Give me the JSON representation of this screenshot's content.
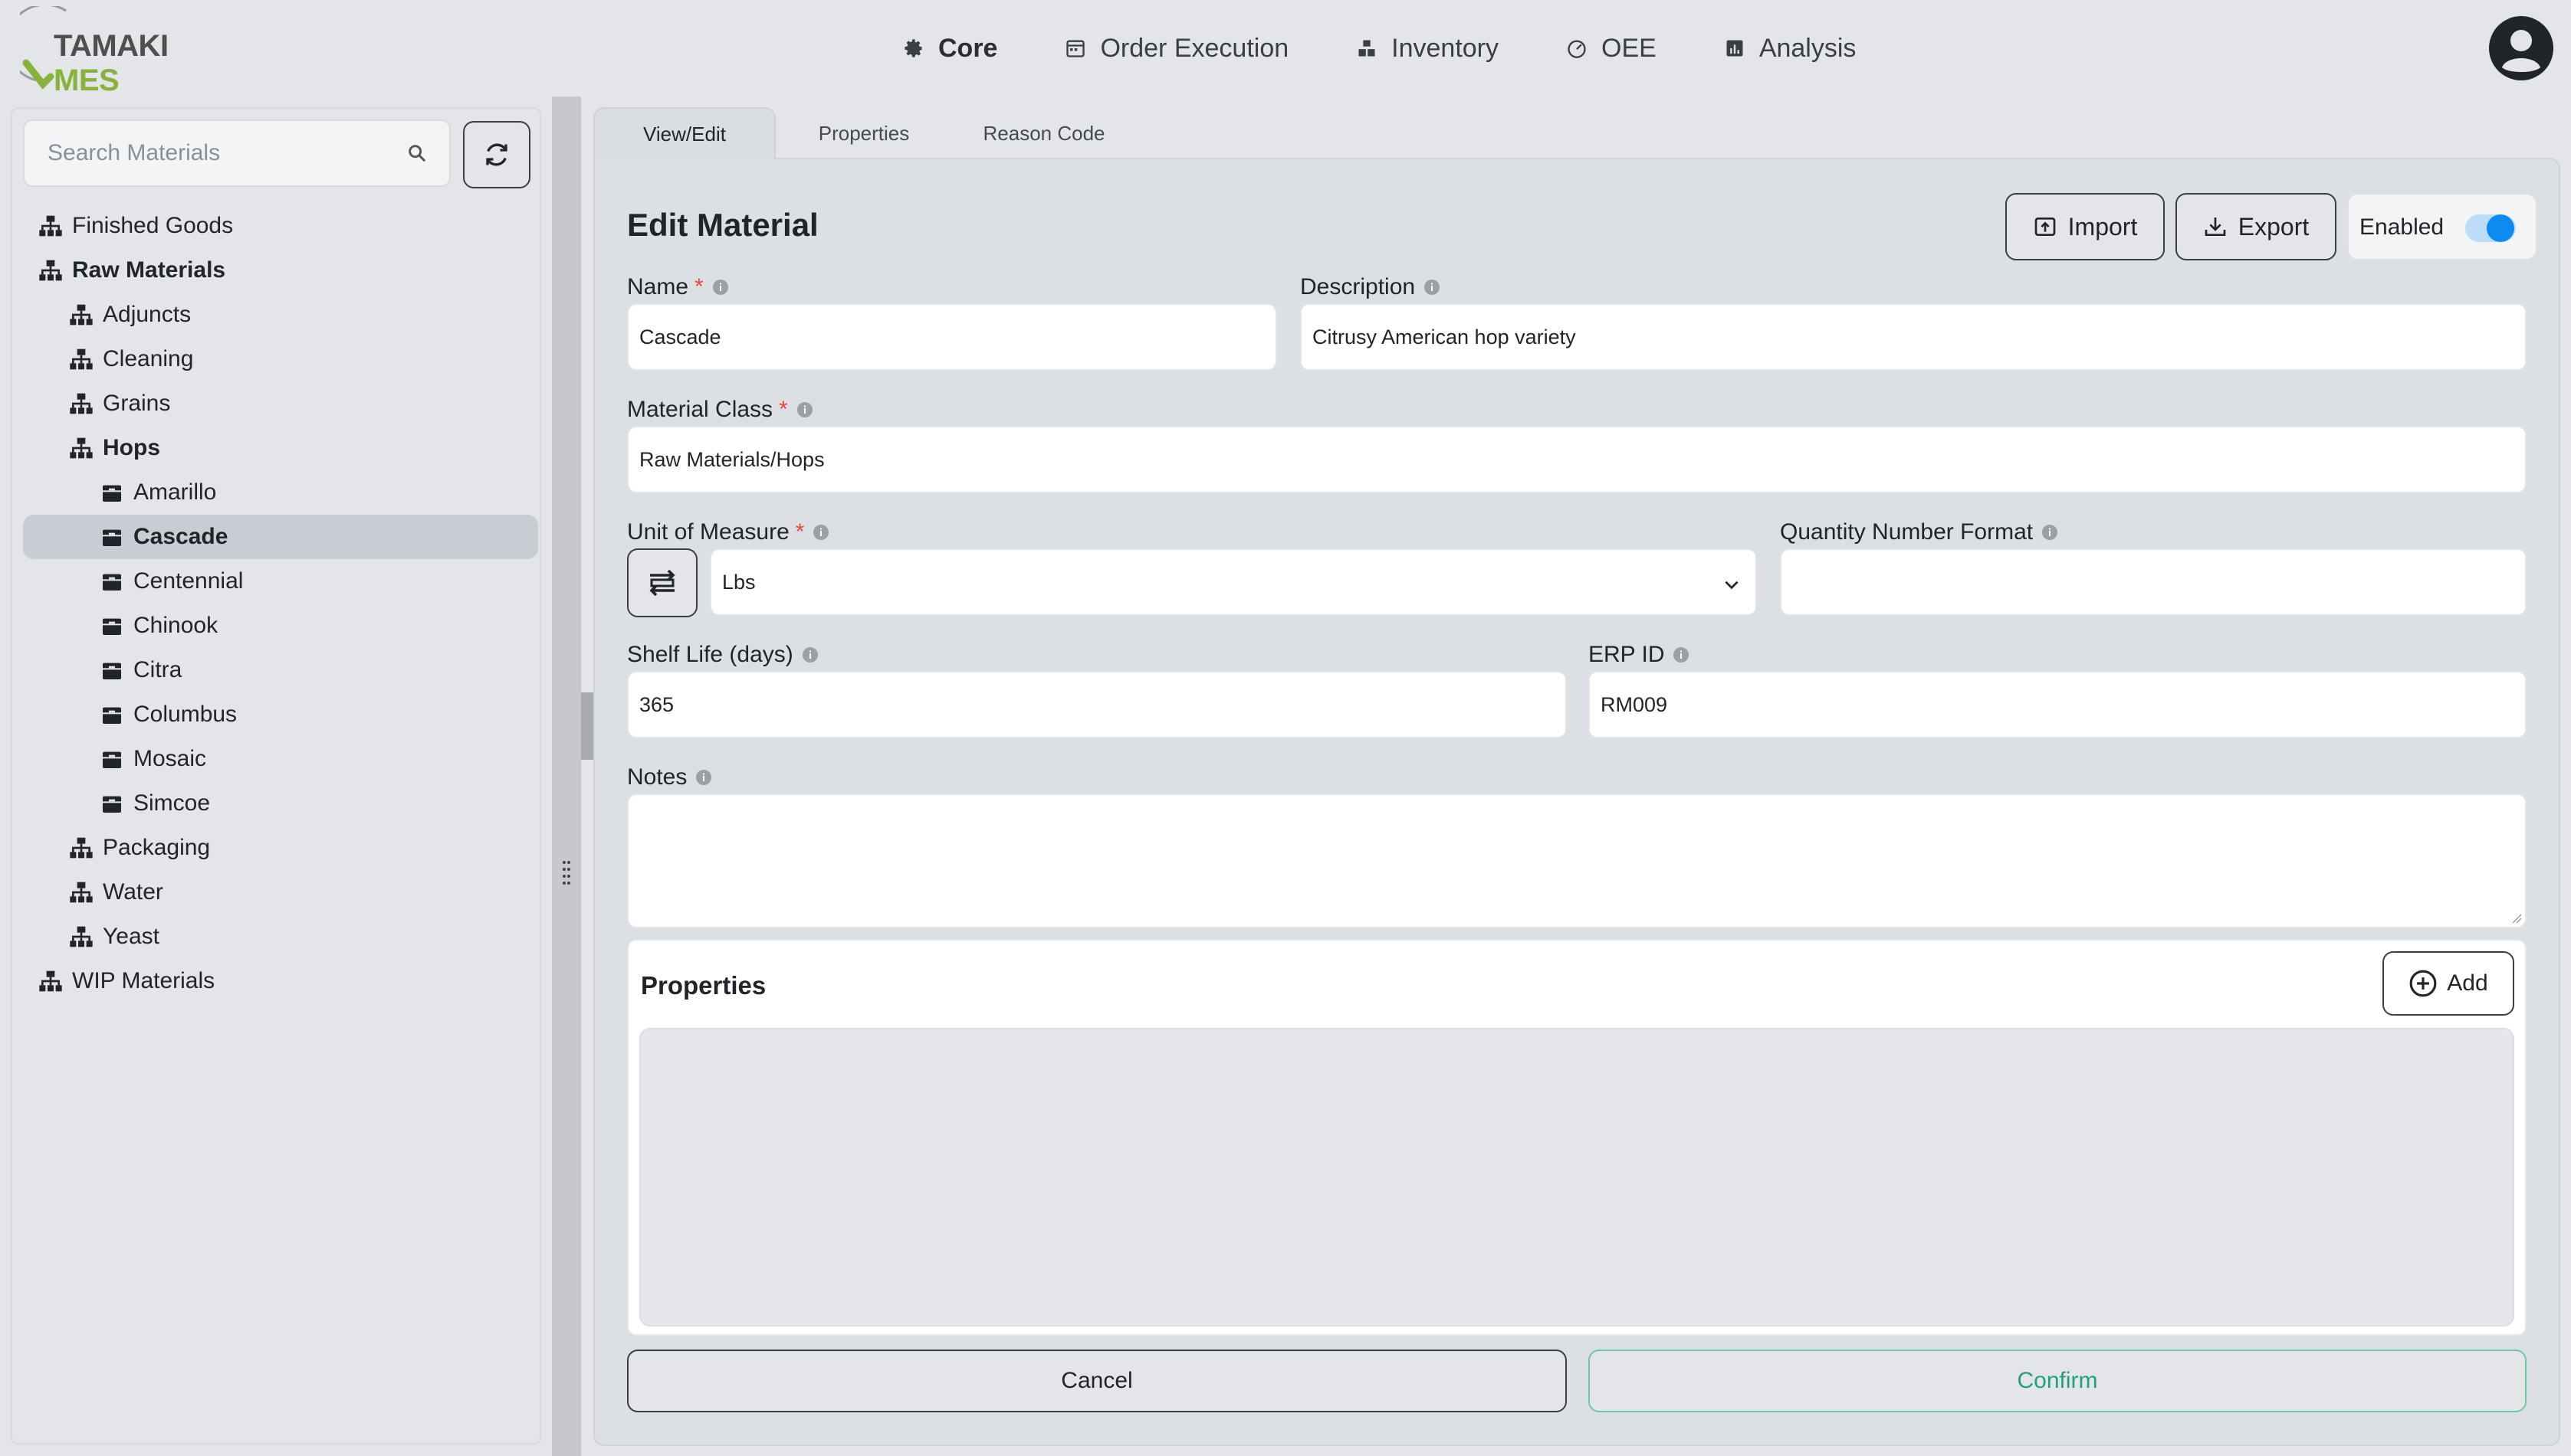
{
  "brand": {
    "part1": "TAMAKI",
    "part2": "MES",
    "accent": "#88b23d"
  },
  "nav": {
    "items": [
      {
        "label": "Core",
        "icon": "gear-icon",
        "active": true
      },
      {
        "label": "Order Execution",
        "icon": "calendar-icon",
        "active": false
      },
      {
        "label": "Inventory",
        "icon": "boxes-icon",
        "active": false
      },
      {
        "label": "OEE",
        "icon": "gauge-icon",
        "active": false
      },
      {
        "label": "Analysis",
        "icon": "chart-icon",
        "active": false
      }
    ]
  },
  "sidebar": {
    "search_placeholder": "Search Materials",
    "tree": [
      {
        "label": "Finished Goods",
        "level": 0,
        "type": "class",
        "bold": false
      },
      {
        "label": "Raw Materials",
        "level": 0,
        "type": "class",
        "bold": true
      },
      {
        "label": "Adjuncts",
        "level": 1,
        "type": "class",
        "bold": false
      },
      {
        "label": "Cleaning",
        "level": 1,
        "type": "class",
        "bold": false
      },
      {
        "label": "Grains",
        "level": 1,
        "type": "class",
        "bold": false
      },
      {
        "label": "Hops",
        "level": 1,
        "type": "class",
        "bold": true
      },
      {
        "label": "Amarillo",
        "level": 2,
        "type": "material",
        "bold": false
      },
      {
        "label": "Cascade",
        "level": 2,
        "type": "material",
        "bold": true,
        "selected": true
      },
      {
        "label": "Centennial",
        "level": 2,
        "type": "material",
        "bold": false
      },
      {
        "label": "Chinook",
        "level": 2,
        "type": "material",
        "bold": false
      },
      {
        "label": "Citra",
        "level": 2,
        "type": "material",
        "bold": false
      },
      {
        "label": "Columbus",
        "level": 2,
        "type": "material",
        "bold": false
      },
      {
        "label": "Mosaic",
        "level": 2,
        "type": "material",
        "bold": false
      },
      {
        "label": "Simcoe",
        "level": 2,
        "type": "material",
        "bold": false
      },
      {
        "label": "Packaging",
        "level": 1,
        "type": "class",
        "bold": false
      },
      {
        "label": "Water",
        "level": 1,
        "type": "class",
        "bold": false
      },
      {
        "label": "Yeast",
        "level": 1,
        "type": "class",
        "bold": false
      },
      {
        "label": "WIP Materials",
        "level": 0,
        "type": "class",
        "bold": false
      }
    ]
  },
  "tabs": [
    {
      "label": "View/Edit",
      "active": true
    },
    {
      "label": "Properties",
      "active": false
    },
    {
      "label": "Reason Code",
      "active": false
    }
  ],
  "form": {
    "title": "Edit Material",
    "import_label": "Import",
    "export_label": "Export",
    "enabled_label": "Enabled",
    "enabled": true,
    "required_mark": "*",
    "name_label": "Name",
    "name_value": "Cascade",
    "description_label": "Description",
    "description_value": "Citrusy American hop variety",
    "material_class_label": "Material Class",
    "material_class_value": "Raw Materials/Hops",
    "uom_label": "Unit of Measure",
    "uom_value": "Lbs",
    "qty_format_label": "Quantity Number Format",
    "qty_format_value": "",
    "shelf_life_label": "Shelf Life (days)",
    "shelf_life_value": "365",
    "erp_id_label": "ERP ID",
    "erp_id_value": "RM009",
    "notes_label": "Notes",
    "notes_value": ""
  },
  "properties": {
    "title": "Properties",
    "add_label": "Add"
  },
  "actions": {
    "cancel_label": "Cancel",
    "confirm_label": "Confirm"
  },
  "colors": {
    "toggle_on": "#0d8bf0",
    "confirm": "#23a07a",
    "required": "#e74c3c"
  }
}
